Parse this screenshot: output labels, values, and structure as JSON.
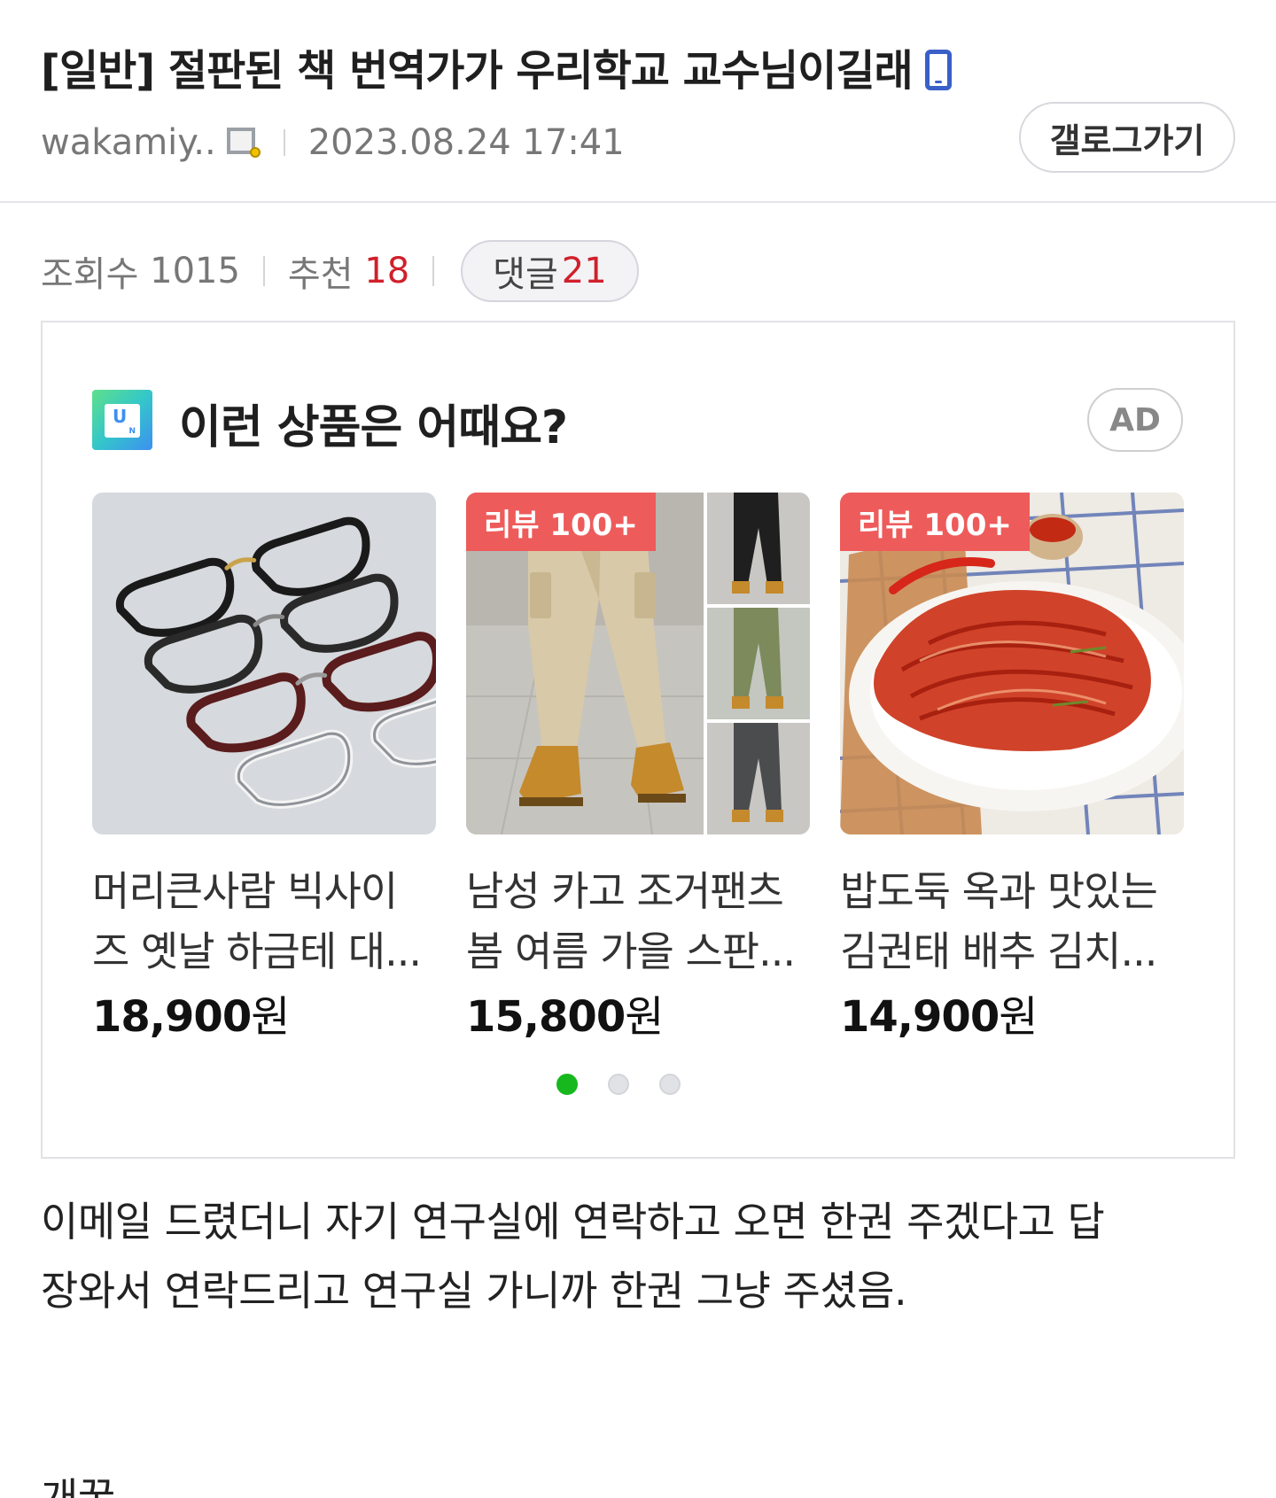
{
  "post": {
    "title": "[일반] 절판된 책 번역가가 우리학교 교수님이길래",
    "author": "wakamiy..",
    "datetime": "2023.08.24 17:41",
    "gallery_button_label": "갤로그가기",
    "icons": {
      "device": "mobile-phone-icon",
      "writer": "fixed-nick-icon"
    }
  },
  "stats": {
    "views_label": "조회수",
    "views": "1015",
    "recommend_label": "추천",
    "recommend": "18",
    "comments_label": "댓글",
    "comments": "21",
    "accent_color": "#d0202b"
  },
  "ad": {
    "heading": "이런 상품은 어때요?",
    "badge": "AD",
    "products": [
      {
        "name_line1": "머리큰사람 빅사이",
        "name_line2": "즈 옛날 하금테 대...",
        "price": "18,900",
        "unit": "원",
        "review_badge": ""
      },
      {
        "name_line1": "남성 카고 조거팬츠",
        "name_line2": "봄 여름 가을 스판...",
        "price": "15,800",
        "unit": "원",
        "review_badge": "리뷰 100+"
      },
      {
        "name_line1": "밥도둑 옥과 맛있는",
        "name_line2": "김권태 배추 김치...",
        "price": "14,900",
        "unit": "원",
        "review_badge": "리뷰 100+"
      }
    ],
    "pager": {
      "pages": 3,
      "active": 1,
      "active_color": "#17b81e"
    }
  },
  "content": {
    "line1": "이메일 드렸더니 자기 연구실에 연락하고 오면 한권 주겠다고 답",
    "line2": "장와서 연락드리고 연구실 가니까 한권 그냥 주셨음.",
    "line3": "개꿀"
  }
}
